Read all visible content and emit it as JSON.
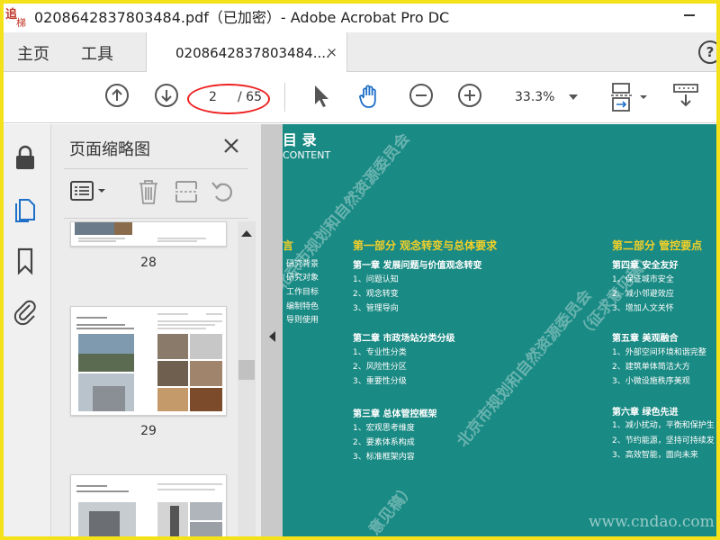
{
  "window": {
    "title": "0208642837803484.pdf（已加密）- Adobe Acrobat Pro DC",
    "logo_text_1": "追",
    "logo_text_2": "梯网"
  },
  "menu_tabs": [
    "主页",
    "工具"
  ],
  "doc_tab": {
    "label": "0208642837803484....",
    "close": "×"
  },
  "toolbar": {
    "current_page": "2",
    "total_pages": "/ 65",
    "zoom": "33.3%",
    "highlight_color": "#e22222"
  },
  "sidebar": {
    "icons": [
      "lock-icon",
      "pages-icon",
      "bookmark-icon",
      "attachment-icon"
    ]
  },
  "thumb_panel": {
    "title": "页面缩略图",
    "close": "✕",
    "thumbnails": [
      {
        "page": "28"
      },
      {
        "page": "29"
      }
    ]
  },
  "document": {
    "heading": "目 录",
    "subheading": "CONTENT",
    "intro_title": "言",
    "intro_items": [
      "研究背景",
      "研究对象",
      "工作目标",
      "编制特色",
      "导则使用"
    ],
    "part1": {
      "title": "第一部分 观念转变与总体要求",
      "chapters": [
        {
          "title": "第一章 发展问题与价值观念转变",
          "items": [
            "1、问题认知",
            "2、观念转变",
            "3、管理导向"
          ]
        },
        {
          "title": "第二章 市政场站分类分级",
          "items": [
            "1、专业性分类",
            "2、风险性分区",
            "3、重要性分级"
          ]
        },
        {
          "title": "第三章 总体管控框架",
          "items": [
            "1、宏观思考维度",
            "2、要素体系构成",
            "3、标准框架内容"
          ]
        }
      ]
    },
    "part2": {
      "title": "第二部分 管控要点",
      "chapters": [
        {
          "title": "第四章 安全友好",
          "items": [
            "1、保证城市安全",
            "2、减小邻避效应",
            "3、增加人文关怀"
          ]
        },
        {
          "title": "第五章 美观融合",
          "items": [
            "1、外部空间环境和谐完整",
            "2、建筑单体简洁大方",
            "3、小微设施秩序美观"
          ]
        },
        {
          "title": "第六章 绿色先进",
          "items": [
            "1、减小扰动，平衡和保护生",
            "2、节约能源，坚持可持续发",
            "3、高效智能，面向未来"
          ]
        }
      ]
    },
    "watermark": "北京市规划和自然资源委员会",
    "watermark_2": "（征求意见稿）",
    "watermark_3": "意见稿）",
    "site_watermark": "www.cndao.com",
    "background_color": "#1a8a84"
  }
}
